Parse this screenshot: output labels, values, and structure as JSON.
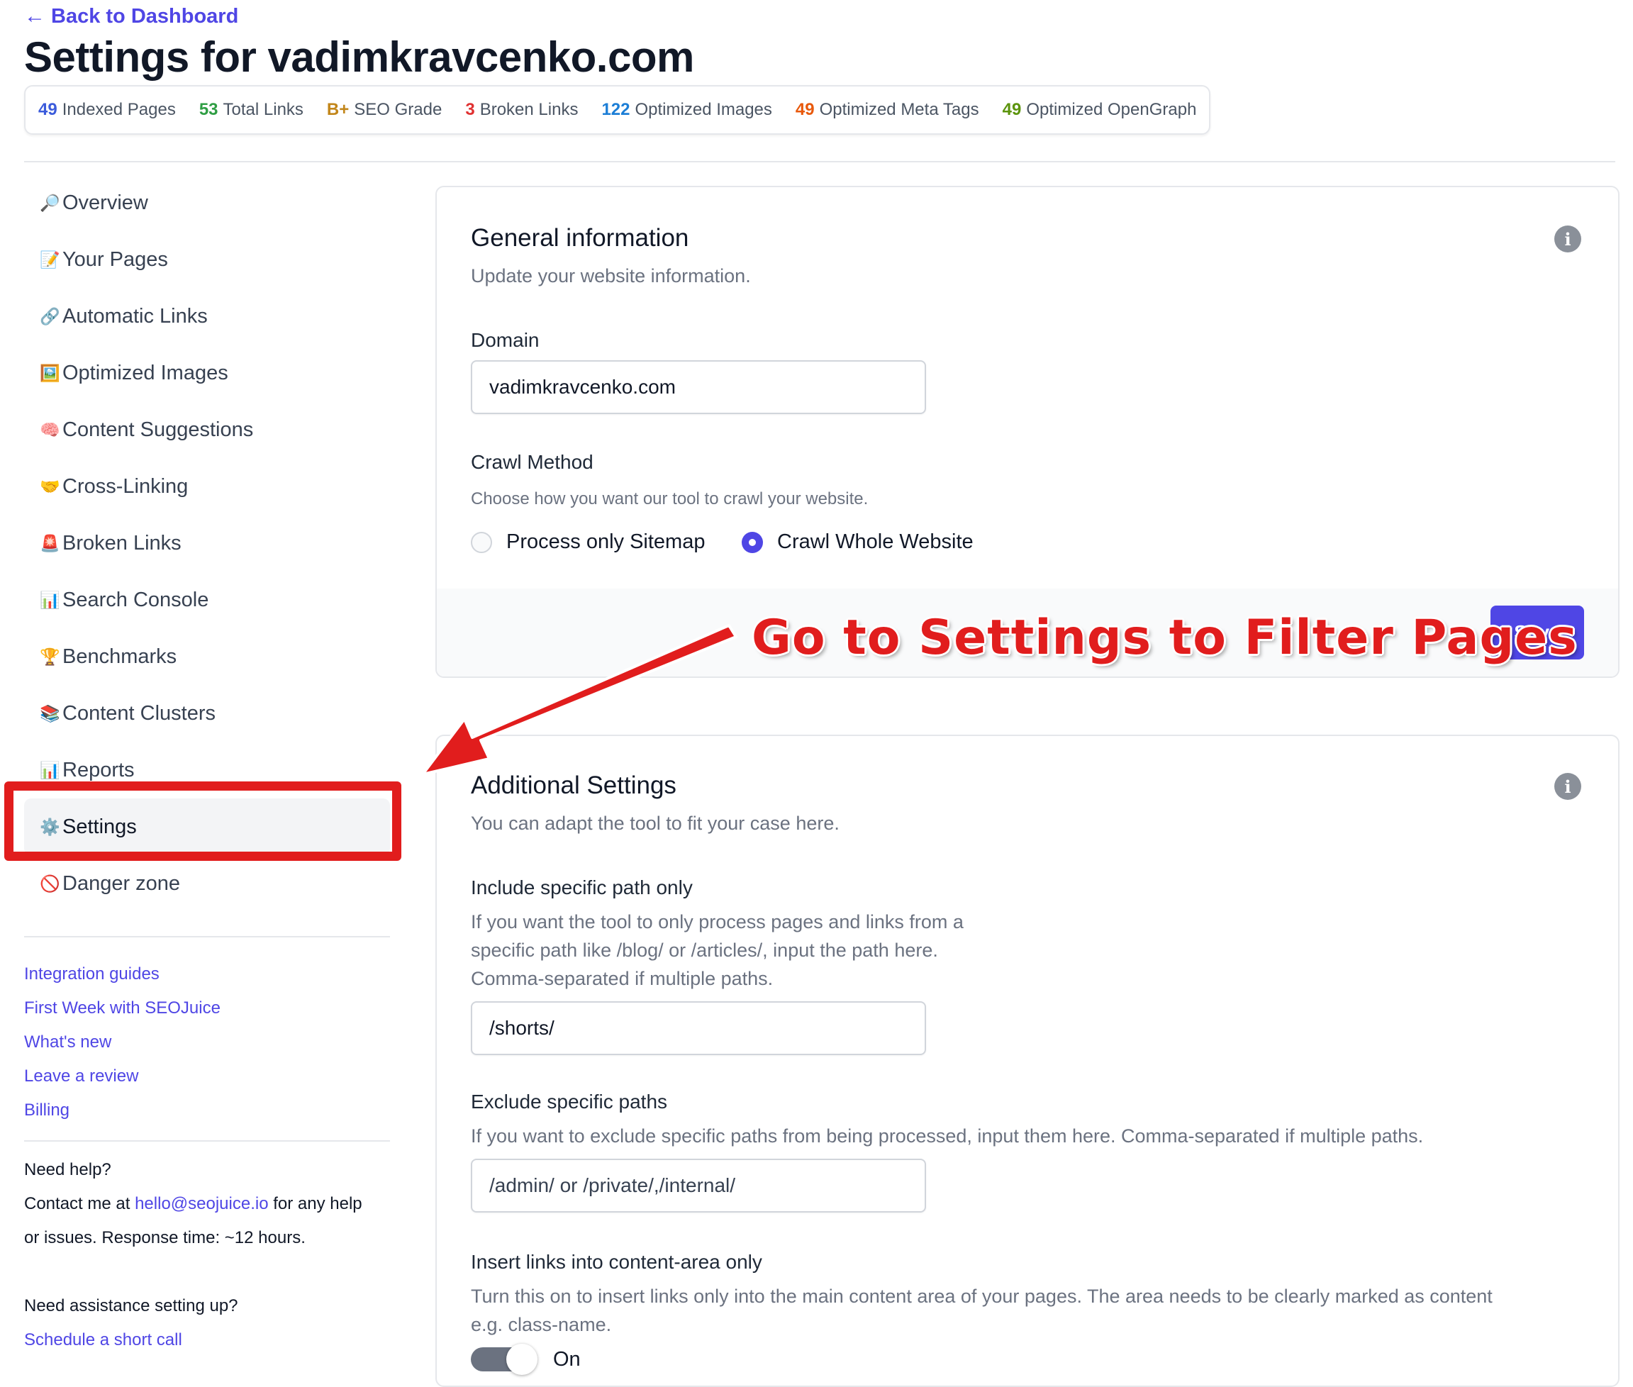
{
  "header": {
    "back_label": "Back to Dashboard",
    "title": "Settings for vadimkravcenko.com"
  },
  "stats": [
    {
      "value": "49",
      "label": "Indexed Pages",
      "color": "#3b5bdb"
    },
    {
      "value": "53",
      "label": "Total Links",
      "color": "#2f9e44"
    },
    {
      "value": "B+",
      "label": "SEO Grade",
      "color": "#c2861a"
    },
    {
      "value": "3",
      "label": "Broken Links",
      "color": "#e03131"
    },
    {
      "value": "122",
      "label": "Optimized Images",
      "color": "#1c7ed6"
    },
    {
      "value": "49",
      "label": "Optimized Meta Tags",
      "color": "#e8590c"
    },
    {
      "value": "49",
      "label": "Optimized OpenGraph",
      "color": "#5c940d"
    }
  ],
  "sidebar": {
    "items": [
      {
        "icon": "🔎",
        "icon_name": "magnifier-icon",
        "label": "Overview"
      },
      {
        "icon": "📝",
        "icon_name": "memo-icon",
        "label": "Your Pages"
      },
      {
        "icon": "🔗",
        "icon_name": "link-icon",
        "label": "Automatic Links"
      },
      {
        "icon": "🖼️",
        "icon_name": "picture-icon",
        "label": "Optimized Images"
      },
      {
        "icon": "🧠",
        "icon_name": "brain-icon",
        "label": "Content Suggestions"
      },
      {
        "icon": "🤝",
        "icon_name": "handshake-icon",
        "label": "Cross-Linking"
      },
      {
        "icon": "🚨",
        "icon_name": "siren-icon",
        "label": "Broken Links"
      },
      {
        "icon": "📊",
        "icon_name": "bar-chart-icon",
        "label": "Search Console"
      },
      {
        "icon": "🏆",
        "icon_name": "trophy-icon",
        "label": "Benchmarks"
      },
      {
        "icon": "📚",
        "icon_name": "books-icon",
        "label": "Content Clusters"
      },
      {
        "icon": "📊",
        "icon_name": "bar-chart-icon",
        "label": "Reports"
      },
      {
        "icon": "⚙️",
        "icon_name": "gear-icon",
        "label": "Settings"
      },
      {
        "icon": "🚫",
        "icon_name": "prohibited-icon",
        "label": "Danger zone"
      }
    ],
    "active_index": 11,
    "links": [
      "Integration guides",
      "First Week with SEOJuice",
      "What's new",
      "Leave a review",
      "Billing"
    ],
    "help": {
      "heading": "Need help?",
      "contact_prefix": "Contact me at",
      "email": "hello@seojuice.io",
      "contact_suffix": "for any help",
      "contact_line2": "or issues. Response time: ~12 hours.",
      "assist_heading": "Need assistance setting up?",
      "schedule_link": "Schedule a short call"
    }
  },
  "general": {
    "title": "General information",
    "subtitle": "Update your website information.",
    "domain_label": "Domain",
    "domain_value": "vadimkravcenko.com",
    "crawl_label": "Crawl Method",
    "crawl_desc": "Choose how you want our tool to crawl your website.",
    "crawl_options": [
      {
        "label": "Process only Sitemap",
        "checked": false
      },
      {
        "label": "Crawl Whole Website",
        "checked": true
      }
    ],
    "save_label": "Save"
  },
  "additional": {
    "title": "Additional Settings",
    "subtitle": "You can adapt the tool to fit your case here.",
    "include_label": "Include specific path only",
    "include_desc": [
      "If you want the tool to only process pages and links from a",
      "specific path like /blog/ or /articles/, input the path here.",
      "Comma-separated if multiple paths."
    ],
    "include_value": "/shorts/",
    "exclude_label": "Exclude specific paths",
    "exclude_desc": "If you want to exclude specific paths from being processed, input them here. Comma-separated if multiple paths.",
    "exclude_placeholder": "/admin/ or /private/,/internal/",
    "content_area_label": "Insert links into content-area only",
    "content_area_desc": [
      "Turn this on to insert links only into the main content area of your pages. The area needs to be clearly marked as content",
      "e.g. class-name."
    ],
    "toggle_label": "On"
  },
  "annotation": {
    "text": "Go to Settings to Filter Pages",
    "color": "#e11d1d"
  },
  "colors": {
    "accent": "#4f46e5"
  }
}
